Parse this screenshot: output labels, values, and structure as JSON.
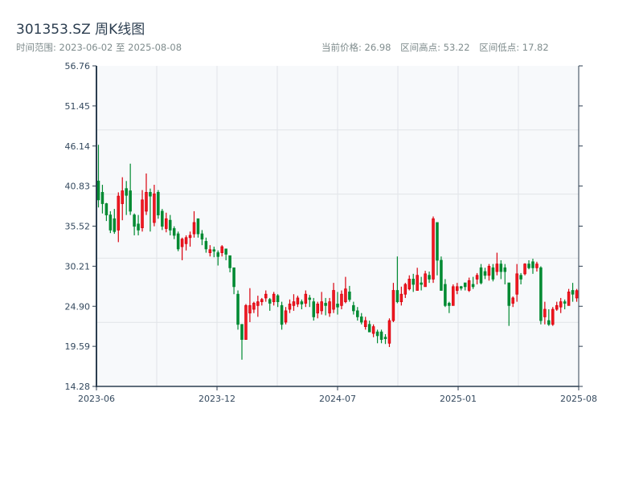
{
  "header": {
    "title": "301353.SZ 周K线图",
    "range_label": "时间范围: 2023-06-02 至 2025-08-08",
    "current_price": "当前价格: 26.98",
    "range_high": "区间高点: 53.22",
    "range_low": "区间低点: 17.82"
  },
  "colors": {
    "up": "#d9000d",
    "down": "#008a32",
    "axis": "#2c3e50",
    "plot_bg": "#f7f9fb",
    "grid": "#e1e4e8"
  },
  "chart_data": {
    "type": "candlestick",
    "title": "301353.SZ 周K线图",
    "ylim": [
      14.28,
      56.76
    ],
    "yticks": [
      "14.28",
      "19.59",
      "24.90",
      "30.21",
      "35.52",
      "40.83",
      "46.14",
      "51.45",
      "56.76"
    ],
    "xticks": [
      "2023-06",
      "2023-12",
      "2024-07",
      "2025-01",
      "2025-08"
    ],
    "grid": true,
    "ohlc_fields": [
      "open",
      "close",
      "high",
      "low"
    ],
    "candles": [
      [
        41.5,
        39.0,
        46.3,
        38.0
      ],
      [
        40.0,
        38.5,
        41.0,
        37.2
      ],
      [
        38.5,
        37.0,
        38.6,
        36.2
      ],
      [
        37.0,
        35.0,
        37.5,
        34.6
      ],
      [
        36.5,
        34.8,
        37.8,
        34.5
      ],
      [
        35.0,
        39.5,
        40.0,
        33.4
      ],
      [
        38.5,
        40.2,
        42.0,
        36.3
      ],
      [
        40.5,
        39.6,
        41.5,
        37.0
      ],
      [
        40.2,
        37.5,
        43.8,
        37.0
      ],
      [
        37.0,
        35.5,
        37.2,
        34.3
      ],
      [
        35.8,
        35.0,
        37.0,
        34.3
      ],
      [
        35.3,
        39.0,
        40.3,
        34.8
      ],
      [
        37.5,
        40.0,
        42.5,
        37.0
      ],
      [
        40.0,
        39.5,
        40.5,
        34.8
      ],
      [
        36.0,
        39.8,
        41.0,
        35.5
      ],
      [
        40.0,
        37.0,
        40.3,
        36.5
      ],
      [
        37.5,
        35.5,
        37.8,
        35.0
      ],
      [
        35.2,
        36.5,
        37.3,
        34.7
      ],
      [
        36.3,
        35.0,
        37.0,
        34.3
      ],
      [
        35.2,
        34.3,
        35.5,
        33.8
      ],
      [
        34.5,
        32.5,
        34.8,
        32.2
      ],
      [
        32.8,
        33.8,
        34.0,
        31.0
      ],
      [
        33.2,
        34.0,
        34.3,
        32.3
      ],
      [
        34.0,
        34.3,
        34.8,
        32.8
      ],
      [
        34.5,
        36.0,
        37.5,
        34.0
      ],
      [
        36.5,
        34.5,
        36.5,
        34.0
      ],
      [
        34.5,
        33.8,
        35.0,
        33.0
      ],
      [
        33.5,
        32.5,
        34.0,
        32.0
      ],
      [
        32.0,
        32.4,
        33.0,
        31.5
      ],
      [
        32.4,
        32.2,
        32.8,
        31.4
      ],
      [
        32.0,
        31.5,
        32.3,
        30.3
      ],
      [
        32.0,
        32.8,
        33.0,
        31.5
      ],
      [
        32.5,
        31.8,
        32.5,
        31.0
      ],
      [
        31.6,
        30.0,
        31.6,
        29.4
      ],
      [
        30.0,
        27.5,
        30.0,
        26.5
      ],
      [
        26.5,
        22.5,
        27.0,
        21.8
      ],
      [
        22.5,
        20.5,
        22.5,
        17.82
      ],
      [
        20.5,
        25.0,
        25.2,
        20.5
      ],
      [
        24.0,
        25.0,
        27.3,
        22.8
      ],
      [
        24.5,
        25.3,
        25.5,
        24.0
      ],
      [
        25.0,
        25.5,
        26.3,
        23.5
      ],
      [
        25.5,
        25.8,
        26.0,
        25.0
      ],
      [
        26.0,
        26.5,
        27.0,
        25.5
      ],
      [
        25.8,
        25.3,
        26.0,
        24.3
      ],
      [
        25.5,
        26.5,
        26.8,
        25.0
      ],
      [
        26.3,
        25.5,
        26.5,
        24.8
      ],
      [
        25.0,
        22.5,
        25.5,
        21.8
      ],
      [
        22.8,
        24.3,
        24.8,
        22.5
      ],
      [
        24.5,
        25.2,
        25.8,
        24.0
      ],
      [
        25.0,
        25.5,
        26.5,
        24.3
      ],
      [
        25.2,
        26.0,
        26.3,
        24.8
      ],
      [
        25.5,
        25.2,
        25.8,
        24.5
      ],
      [
        25.3,
        26.5,
        27.0,
        24.8
      ],
      [
        26.0,
        25.8,
        26.4,
        24.8
      ],
      [
        25.5,
        23.5,
        26.0,
        23.0
      ],
      [
        24.0,
        25.2,
        25.5,
        23.3
      ],
      [
        24.3,
        25.5,
        26.8,
        23.8
      ],
      [
        25.3,
        25.0,
        26.0,
        23.7
      ],
      [
        24.0,
        25.5,
        26.0,
        23.5
      ],
      [
        24.5,
        27.0,
        28.0,
        24.0
      ],
      [
        25.2,
        24.8,
        26.8,
        23.8
      ],
      [
        25.0,
        26.5,
        27.0,
        24.5
      ],
      [
        25.5,
        27.2,
        28.8,
        25.3
      ],
      [
        26.8,
        25.8,
        27.6,
        25.5
      ],
      [
        25.0,
        24.3,
        25.5,
        23.8
      ],
      [
        24.3,
        23.5,
        24.8,
        23.0
      ],
      [
        23.5,
        22.8,
        24.0,
        22.5
      ],
      [
        22.2,
        23.0,
        23.5,
        21.8
      ],
      [
        22.5,
        21.5,
        23.0,
        21.5
      ],
      [
        21.3,
        22.2,
        22.5,
        20.8
      ],
      [
        21.5,
        21.0,
        21.8,
        20.0
      ],
      [
        21.5,
        20.5,
        21.8,
        20.0
      ],
      [
        20.8,
        20.6,
        21.2,
        19.9
      ],
      [
        20.0,
        23.0,
        23.3,
        19.5
      ],
      [
        23.0,
        27.0,
        28.0,
        22.8
      ],
      [
        27.0,
        25.5,
        31.5,
        25.3
      ],
      [
        25.5,
        26.5,
        27.5,
        25.0
      ],
      [
        26.5,
        27.8,
        28.0,
        26.0
      ],
      [
        27.2,
        28.5,
        29.0,
        27.0
      ],
      [
        28.5,
        27.8,
        29.2,
        26.8
      ],
      [
        27.0,
        29.0,
        30.0,
        27.0
      ],
      [
        28.0,
        27.8,
        28.8,
        27.0
      ],
      [
        27.5,
        29.2,
        29.6,
        27.5
      ],
      [
        29.0,
        28.5,
        29.5,
        28.0
      ],
      [
        28.5,
        36.5,
        36.8,
        28.0
      ],
      [
        36.0,
        31.0,
        36.0,
        29.0
      ],
      [
        31.0,
        27.0,
        31.5,
        27.0
      ],
      [
        27.8,
        25.0,
        28.5,
        24.8
      ],
      [
        25.3,
        25.0,
        25.5,
        24.0
      ],
      [
        25.0,
        27.5,
        27.8,
        25.5
      ],
      [
        27.0,
        27.5,
        28.0,
        26.5
      ],
      [
        27.5,
        27.3,
        27.6,
        27.0
      ],
      [
        28.0,
        27.5,
        28.0,
        27.0
      ],
      [
        27.0,
        28.3,
        28.7,
        26.8
      ],
      [
        27.8,
        27.5,
        28.8,
        27.2
      ],
      [
        28.5,
        29.0,
        29.3,
        27.8
      ],
      [
        30.0,
        28.0,
        30.5,
        27.8
      ],
      [
        29.5,
        29.0,
        30.0,
        28.5
      ],
      [
        29.0,
        30.2,
        30.5,
        28.3
      ],
      [
        30.0,
        28.5,
        30.5,
        28.2
      ],
      [
        29.5,
        30.5,
        32.0,
        29.0
      ],
      [
        30.5,
        29.5,
        31.0,
        28.5
      ],
      [
        30.0,
        29.5,
        30.5,
        27.8
      ],
      [
        28.0,
        25.0,
        28.0,
        22.3
      ],
      [
        25.3,
        26.0,
        26.2,
        24.8
      ],
      [
        26.5,
        29.2,
        30.5,
        25.5
      ],
      [
        29.0,
        28.5,
        29.3,
        27.8
      ],
      [
        29.2,
        30.5,
        30.6,
        29.0
      ],
      [
        30.5,
        30.0,
        31.0,
        29.8
      ],
      [
        30.8,
        30.0,
        31.2,
        29.2
      ],
      [
        30.0,
        30.5,
        30.8,
        29.5
      ],
      [
        30.0,
        23.0,
        30.2,
        22.5
      ],
      [
        23.5,
        24.5,
        25.5,
        22.5
      ],
      [
        23.0,
        22.5,
        24.5,
        22.3
      ],
      [
        22.5,
        24.5,
        24.8,
        22.3
      ],
      [
        24.5,
        25.0,
        25.5,
        24.3
      ],
      [
        24.8,
        25.5,
        26.0,
        24.0
      ],
      [
        25.5,
        25.3,
        25.8,
        24.5
      ],
      [
        25.0,
        26.8,
        27.2,
        25.0
      ],
      [
        27.0,
        26.5,
        28.0,
        25.5
      ],
      [
        26.0,
        26.98,
        27.2,
        25.5
      ]
    ]
  }
}
